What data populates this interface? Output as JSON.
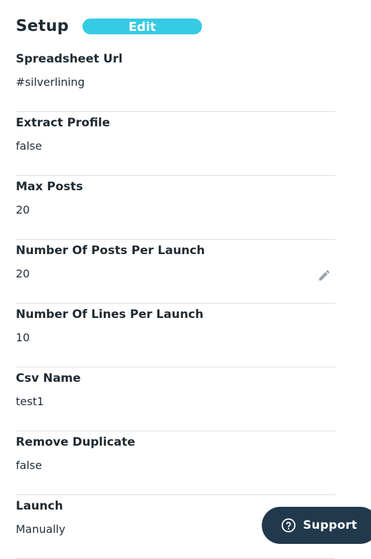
{
  "setup": {
    "title": "Setup",
    "edit_label": "Edit"
  },
  "fields": [
    {
      "label": "Spreadsheet Url",
      "value": "#silverlining"
    },
    {
      "label": "Extract Profile",
      "value": "false"
    },
    {
      "label": "Max Posts",
      "value": "20"
    },
    {
      "label": "Number Of Posts Per Launch",
      "value": "20"
    },
    {
      "label": "Number Of Lines Per Launch",
      "value": "10"
    },
    {
      "label": "Csv Name",
      "value": "test1"
    },
    {
      "label": "Remove Duplicate",
      "value": "false"
    },
    {
      "label": "Launch",
      "value": "Manually"
    }
  ],
  "support": {
    "label": "Support",
    "icon": "question-circle-icon"
  },
  "icons": {
    "edit_field": "pencil-icon"
  },
  "colors": {
    "edit_button": "#36cbe3",
    "support_button": "#22394d",
    "divider": "#d9dde1",
    "text": "#1f2a33"
  }
}
